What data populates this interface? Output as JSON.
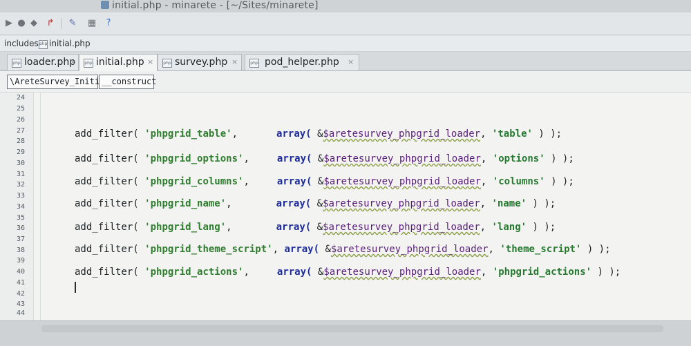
{
  "window": {
    "title": "initial.php - minarete - [~/Sites/minarete]"
  },
  "toolbar": {
    "icons": [
      "play-icon",
      "bug-icon",
      "stop-icon",
      "step-icon",
      "build-icon",
      "settings-icon",
      "help-icon"
    ]
  },
  "breadcrumb": {
    "folder": "includes",
    "file": "initial.php",
    "file_icon": "php"
  },
  "tabs": [
    {
      "label": "loader.php",
      "icon": "php",
      "close": "×",
      "active": false
    },
    {
      "label": "initial.php",
      "icon": "php",
      "close": "×",
      "active": true
    },
    {
      "label": "survey.php",
      "icon": "php",
      "close": "×",
      "active": false
    },
    {
      "label": "pod_helper.php",
      "icon": "php",
      "close": "×",
      "active": false
    }
  ],
  "navigation": {
    "class_name": "\\AreteSurvey_Initial",
    "method_name": "__construct"
  },
  "editor": {
    "line_numbers": [
      "24",
      "25",
      "26",
      "27",
      "28",
      "29",
      "30",
      "31",
      "32",
      "33",
      "34",
      "35",
      "36",
      "37",
      "38",
      "39",
      "40",
      "41",
      "42",
      "43",
      "44"
    ],
    "lines": [
      {
        "fn": "add_filter(",
        "str": "'phpgrid_table'",
        "comma": ",",
        "kw": "array(",
        "amp": "&",
        "var": "$aretesurvey_phpgrid_loader",
        "arg": "'table'",
        "end": ") );"
      },
      {
        "fn": "add_filter(",
        "str": "'phpgrid_options'",
        "comma": ",",
        "kw": "array(",
        "amp": "&",
        "var": "$aretesurvey_phpgrid_loader",
        "arg": "'options'",
        "end": ") );"
      },
      {
        "fn": "add_filter(",
        "str": "'phpgrid_columns'",
        "comma": ",",
        "kw": "array(",
        "amp": "&",
        "var": "$aretesurvey_phpgrid_loader",
        "arg": "'columns'",
        "end": ") );"
      },
      {
        "fn": "add_filter(",
        "str": "'phpgrid_name'",
        "comma": ",",
        "kw": "array(",
        "amp": "&",
        "var": "$aretesurvey_phpgrid_loader",
        "arg": "'name'",
        "end": ") );"
      },
      {
        "fn": "add_filter(",
        "str": "'phpgrid_lang'",
        "comma": ",",
        "kw": "array(",
        "amp": "&",
        "var": "$aretesurvey_phpgrid_loader",
        "arg": "'lang'",
        "end": ") );"
      },
      {
        "fn": "add_filter(",
        "str": "'phpgrid_theme_script'",
        "comma": ",",
        "kw": "array(",
        "amp": "&",
        "var": "$aretesurvey_phpgrid_loader",
        "arg": "'theme_script'",
        "end": ") );"
      },
      {
        "fn": "add_filter(",
        "str": "'phpgrid_actions'",
        "comma": ",",
        "kw": "array(",
        "amp": "&",
        "var": "$aretesurvey_phpgrid_loader",
        "arg": "'phpgrid_actions'",
        "end": ") );"
      }
    ]
  }
}
